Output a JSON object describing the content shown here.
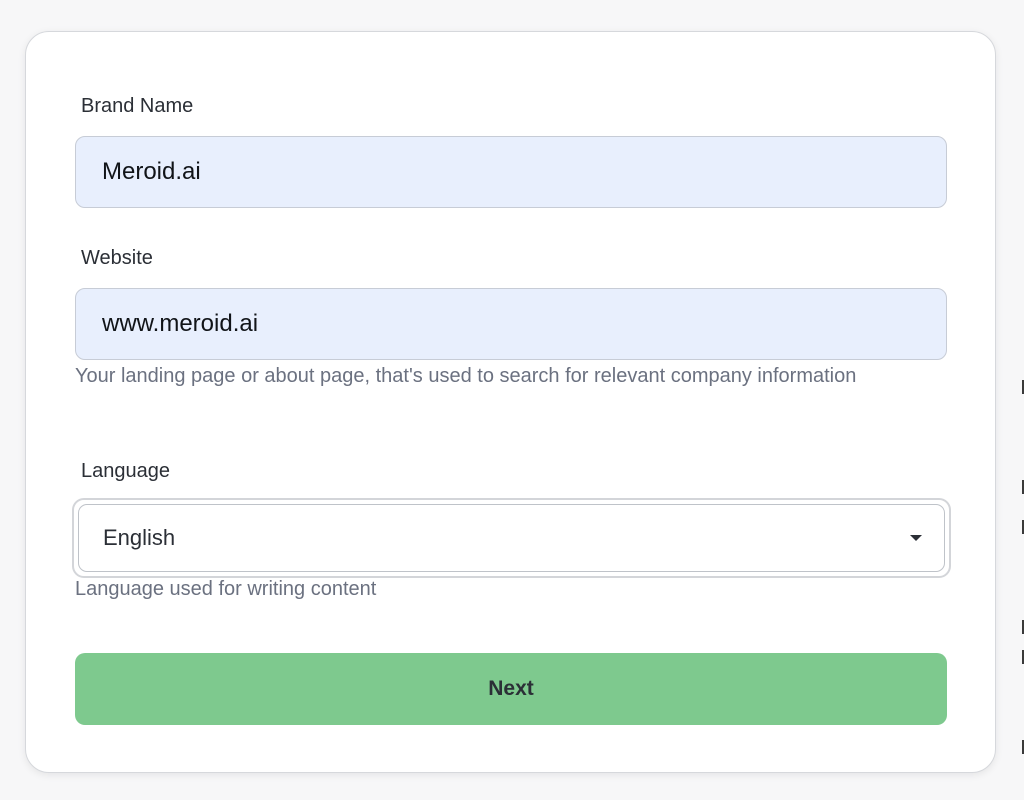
{
  "form": {
    "brand_name": {
      "label": "Brand Name",
      "value": "Meroid.ai"
    },
    "website": {
      "label": "Website",
      "value": "www.meroid.ai",
      "helper": "Your landing page or about page, that's used to search for relevant company information"
    },
    "language": {
      "label": "Language",
      "selected": "English",
      "icon": "caret-down-icon",
      "helper": "Language used for writing content"
    },
    "next_label": "Next"
  },
  "colors": {
    "input_bg": "#e8effd",
    "button_bg": "#7ec98e",
    "helper_text": "#6b7180"
  }
}
